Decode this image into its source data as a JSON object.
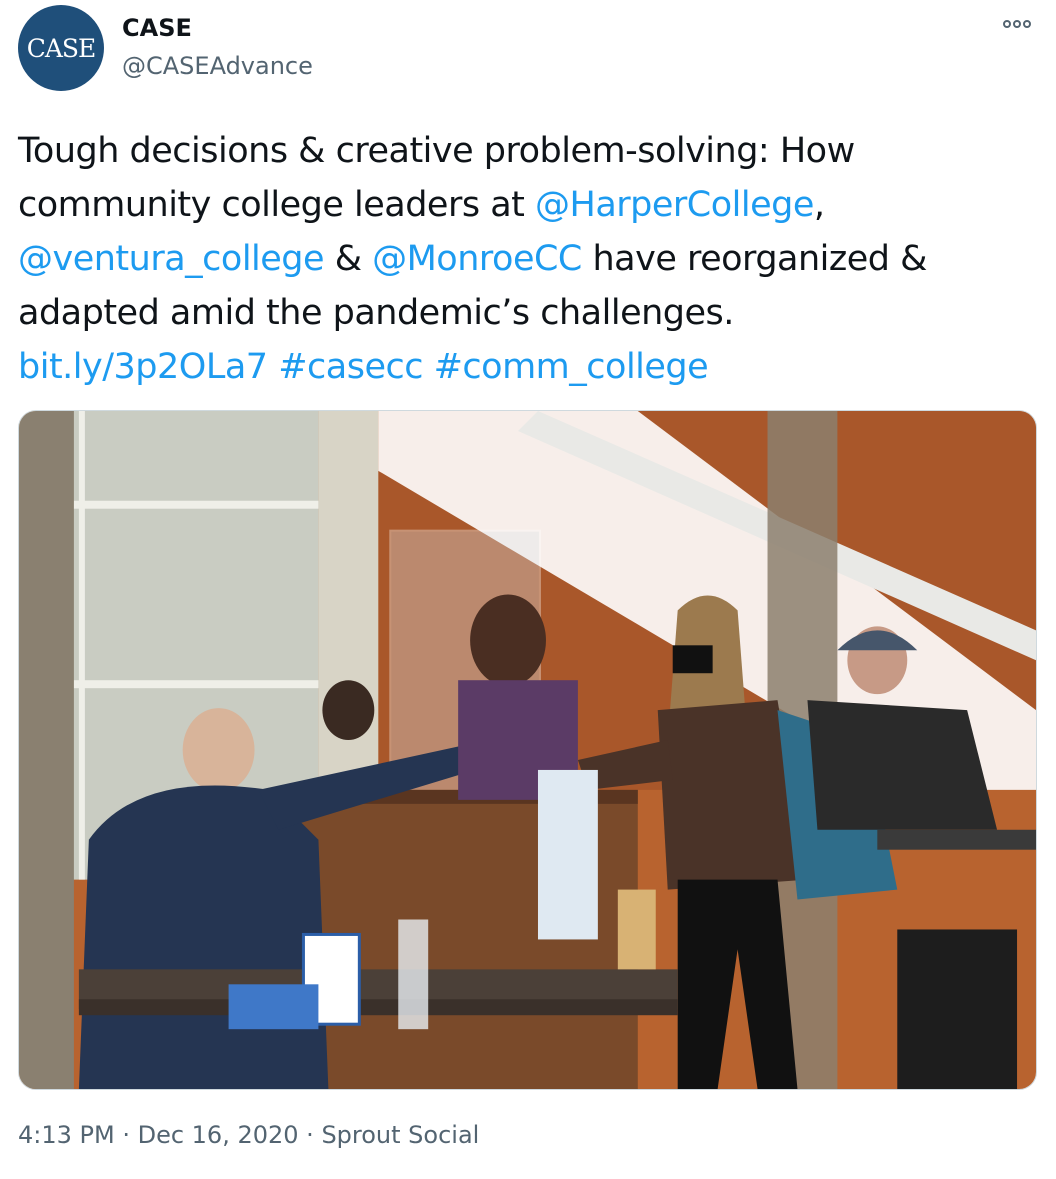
{
  "author": {
    "avatar_text": "CASE",
    "display_name": "CASE",
    "handle": "@CASEAdvance"
  },
  "more_button": "more-options-icon",
  "tweet": {
    "l1": "Tough decisions & creative problem-solving: How",
    "l2a": "community college leaders at ",
    "m1": "@HarperCollege",
    "l2b": ",",
    "m2": "@ventura_college",
    "l3a": " & ",
    "m3": "@MonroeCC",
    "l3b": " have reorganized &",
    "l4": "adapted amid the pandemic’s challenges.",
    "link": "bit.ly/3p2OLa7",
    "sp1": " ",
    "tag1": "#casecc",
    "sp2": " ",
    "tag2": "#comm_college"
  },
  "colors": {
    "link": "#1d9bf0",
    "secondary_text": "#536471",
    "avatar_bg": "#1f4f7a"
  },
  "footer": {
    "time": "4:13 PM",
    "sep1": " · ",
    "date": "Dec 16, 2020",
    "sep2": " · ",
    "source": "Sprout Social"
  }
}
